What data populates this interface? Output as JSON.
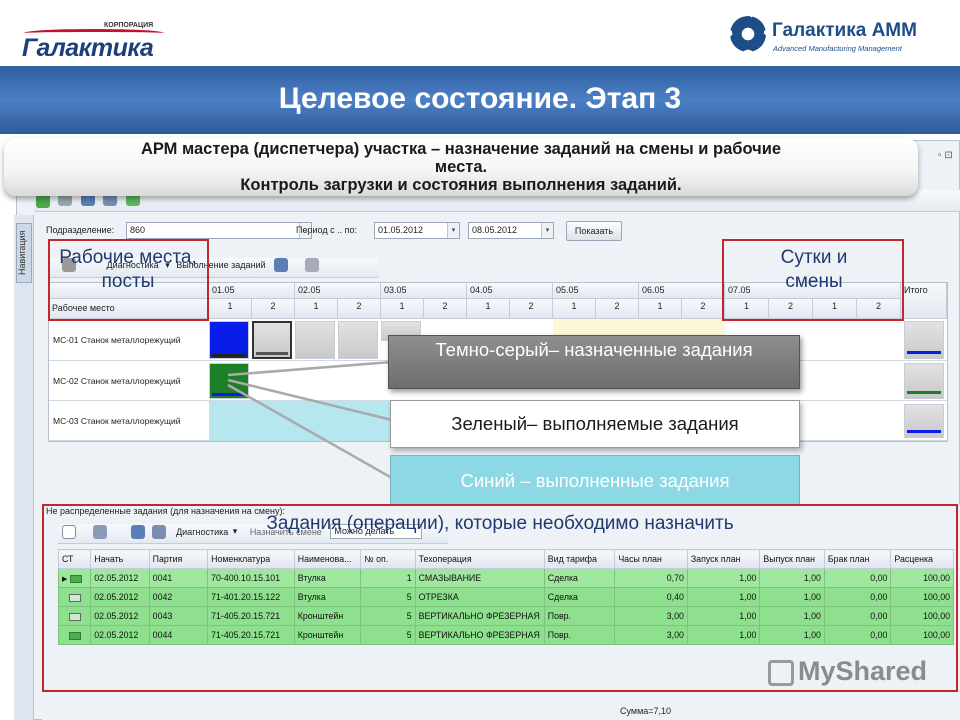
{
  "header": {
    "left_logo_corp": "КОРПОРАЦИЯ",
    "left_logo_name": "Галактика",
    "right_logo_name": "Галактика АММ",
    "right_logo_sub": "Advanced Manufacturing Management"
  },
  "slide": {
    "title": "Целевое состояние. Этап 3",
    "subtitle_line1": "АРМ мастера (диспетчера) участка – назначение заданий на смены и рабочие",
    "subtitle_line2": "места.",
    "subtitle_line3": "Контроль загрузки и состояния выполнения заданий."
  },
  "nav": {
    "label": "Навигация"
  },
  "filters": {
    "division_label": "Подразделение:",
    "division_value": "860",
    "period_label": "Период с .. по:",
    "date_from": "01.05.2012",
    "date_to": "08.05.2012",
    "show_button": "Показать"
  },
  "toolbar2": {
    "diagnostics": "Диагностика",
    "execution": "Выполнение заданий"
  },
  "grid": {
    "workplace_header": "Рабочее место",
    "total_header": "Итого",
    "days": [
      "01.05",
      "02.05",
      "03.05",
      "04.05",
      "05.05",
      "06.05",
      "07.05"
    ],
    "shifts": [
      "1",
      "2"
    ],
    "rows": [
      "МС-01 Станок металлорежущий",
      "МС-02 Станок металлорежущий",
      "МС-03 Станок металлорежущий"
    ]
  },
  "annotations": {
    "workplaces": "Рабочие места, посты",
    "days_shifts": "Сутки и смены",
    "dark_gray": "Темно-серый– назначенные задания",
    "green": "Зеленый– выполняемые задания",
    "blue": "Синий – выполненные задания",
    "tasks": "Задания (операции), которые необходимо назначить"
  },
  "bottom": {
    "title": "Не распределенные задания (для назначения на смену):",
    "diagnostics": "Диагностика",
    "assign_shift": "Назначить смене",
    "can_do": "Можно делать",
    "columns": [
      "СТ",
      "Начать",
      "Партия",
      "Номенклатура",
      "Наименова...",
      "№ оп.",
      "Техоперация",
      "Вид тарифа",
      "Часы план",
      "Запуск план",
      "Выпуск план",
      "Брак план",
      "Расценка"
    ],
    "rows": [
      [
        "02.05.2012",
        "0041",
        "70-400.10.15.101",
        "Втулка",
        "1",
        "СМАЗЫВАНИЕ",
        "Сделка",
        "0,70",
        "1,00",
        "1,00",
        "0,00",
        "100,00"
      ],
      [
        "02.05.2012",
        "0042",
        "71-401.20.15.122",
        "Втулка",
        "5",
        "ОТРЕЗКА",
        "Сделка",
        "0,40",
        "1,00",
        "1,00",
        "0,00",
        "100,00"
      ],
      [
        "02.05.2012",
        "0043",
        "71-405.20.15.721",
        "Кронштейн",
        "5",
        "ВЕРТИКАЛЬНО ФРЕЗЕРНАЯ",
        "Повр.",
        "3,00",
        "1,00",
        "1,00",
        "0,00",
        "100,00"
      ],
      [
        "02.05.2012",
        "0044",
        "71-405.20.15.721",
        "Кронштейн",
        "5",
        "ВЕРТИКАЛЬНО ФРЕЗЕРНАЯ",
        "Повр.",
        "3,00",
        "1,00",
        "1,00",
        "0,00",
        "100,00"
      ]
    ],
    "sum": "Сумма=7,10"
  },
  "watermark": "MyShared"
}
